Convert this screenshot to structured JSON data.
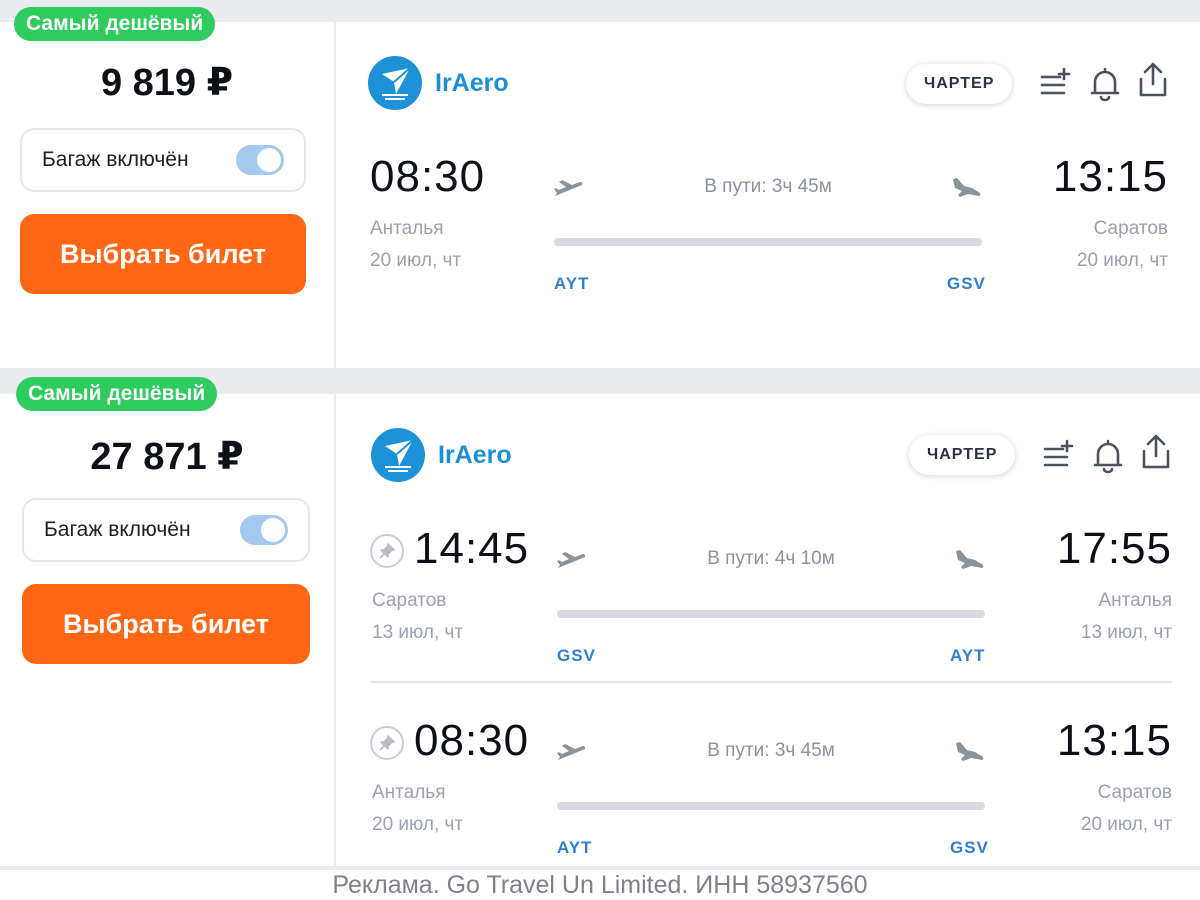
{
  "offers": [
    {
      "badge": "Самый дешёвый",
      "price": "9 819 ₽",
      "baggage_label": "Багаж включён",
      "buy_label": "Выбрать билет",
      "airline": "IrAero",
      "charter_label": "ЧАРТЕР",
      "segments": [
        {
          "dep_time": "08:30",
          "arr_time": "13:15",
          "duration": "В пути: 3ч 45м",
          "dep_city": "Анталья",
          "arr_city": "Саратов",
          "dep_date": "20 июл, чт",
          "arr_date": "20 июл, чт",
          "dep_iata": "AYT",
          "arr_iata": "GSV"
        }
      ]
    },
    {
      "badge": "Самый дешёвый",
      "price": "27 871 ₽",
      "baggage_label": "Багаж включён",
      "buy_label": "Выбрать билет",
      "airline": "IrAero",
      "charter_label": "ЧАРТЕР",
      "segments": [
        {
          "dep_time": "14:45",
          "arr_time": "17:55",
          "duration": "В пути: 4ч 10м",
          "dep_city": "Саратов",
          "arr_city": "Анталья",
          "dep_date": "13 июл, чт",
          "arr_date": "13 июл, чт",
          "dep_iata": "GSV",
          "arr_iata": "AYT"
        },
        {
          "dep_time": "08:30",
          "arr_time": "13:15",
          "duration": "В пути: 3ч 45м",
          "dep_city": "Анталья",
          "arr_city": "Саратов",
          "dep_date": "20 июл, чт",
          "arr_date": "20 июл, чт",
          "dep_iata": "AYT",
          "arr_iata": "GSV"
        }
      ]
    }
  ],
  "baggage_toggle_on": true,
  "icons": [
    "iraero-logo-icon",
    "add-to-list-icon",
    "bell-icon",
    "share-icon",
    "takeoff-icon",
    "landing-icon",
    "pin-icon"
  ],
  "colors": {
    "badge": "#2ecc5e",
    "buy": "#ff6714",
    "airline": "#1d8fd6",
    "iata": "#2f7fd1",
    "toggle": "#a5c8ee"
  },
  "footer": "Реклама. Go Travel Un Limited. ИНН 58937560"
}
